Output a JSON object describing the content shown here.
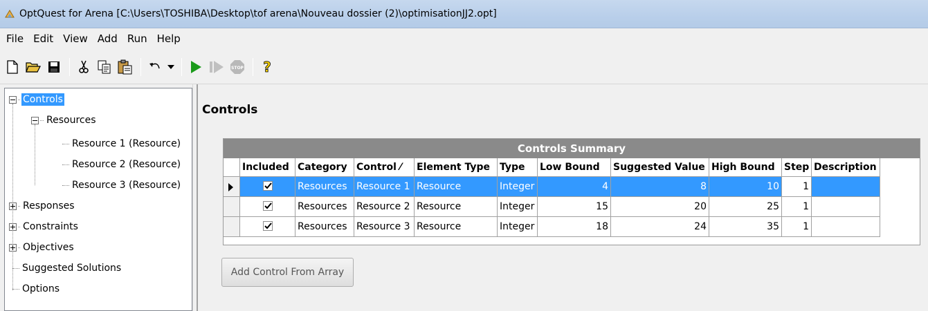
{
  "window": {
    "title": "OptQuest for Arena  [C:\\Users\\TOSHIBA\\Desktop\\tof arena\\Nouveau dossier (2)\\optimisationJJ2.opt]"
  },
  "menu": [
    "File",
    "Edit",
    "View",
    "Add",
    "Run",
    "Help"
  ],
  "toolbar": {
    "buttons": [
      "new-file-icon",
      "open-folder-icon",
      "save-icon",
      "cut-icon",
      "copy-icon",
      "paste-icon",
      "undo-icon",
      "undo-dropdown-icon",
      "run-icon",
      "step-icon",
      "stop-icon",
      "help-icon"
    ],
    "stop_text": "STOP",
    "help_text": "?"
  },
  "tree": {
    "controls": "Controls",
    "resources": "Resources",
    "resource_items": [
      "Resource 1 (Resource)",
      "Resource 2 (Resource)",
      "Resource 3 (Resource)"
    ],
    "responses": "Responses",
    "constraints": "Constraints",
    "objectives": "Objectives",
    "suggested_solutions": "Suggested Solutions",
    "options": "Options"
  },
  "main": {
    "title": "Controls",
    "grid_caption": "Controls Summary",
    "columns": [
      "Included",
      "Category",
      "Control ⁄",
      "Element Type",
      "Type",
      "Low Bound",
      "Suggested Value",
      "High Bound",
      "Step",
      "Description"
    ],
    "rows": [
      {
        "included": true,
        "category": "Resources",
        "control": "Resource 1",
        "element_type": "Resource",
        "type": "Integer",
        "low": "4",
        "suggested": "8",
        "high": "10",
        "step": "1",
        "description": ""
      },
      {
        "included": true,
        "category": "Resources",
        "control": "Resource 2",
        "element_type": "Resource",
        "type": "Integer",
        "low": "15",
        "suggested": "20",
        "high": "25",
        "step": "1",
        "description": ""
      },
      {
        "included": true,
        "category": "Resources",
        "control": "Resource 3",
        "element_type": "Resource",
        "type": "Integer",
        "low": "18",
        "suggested": "24",
        "high": "35",
        "step": "1",
        "description": ""
      }
    ],
    "selected_row": 0,
    "add_button": "Add Control From Array"
  },
  "colors": {
    "selection": "#3399ff",
    "caption_bg": "#8a8a8a",
    "run_green": "#1a9a1a"
  }
}
